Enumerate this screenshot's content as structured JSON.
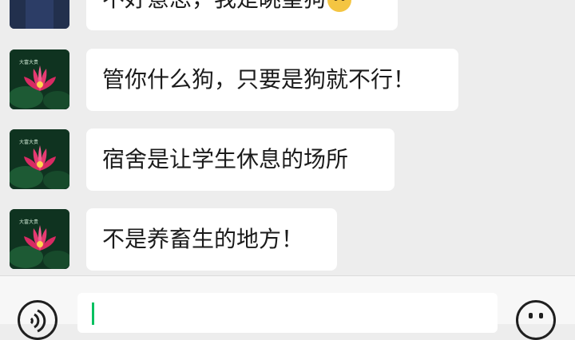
{
  "messages": [
    {
      "text": "不好意思，我是眺望狗",
      "has_emoji": true,
      "emoji_icon": "smiling-dog-emoji"
    },
    {
      "text": "管你什么狗，只要是狗就不行！"
    },
    {
      "text": "宿舍是让学生休息的场所"
    },
    {
      "text": "不是养畜生的地方！"
    }
  ],
  "avatar": {
    "label": "大富大贵",
    "icon": "lotus-avatar"
  },
  "input_bar": {
    "voice_icon": "voice-icon",
    "emoji_icon": "emoji-icon",
    "value": ""
  },
  "colors": {
    "background": "#ededed",
    "bubble": "#ffffff",
    "caret": "#07c160"
  }
}
